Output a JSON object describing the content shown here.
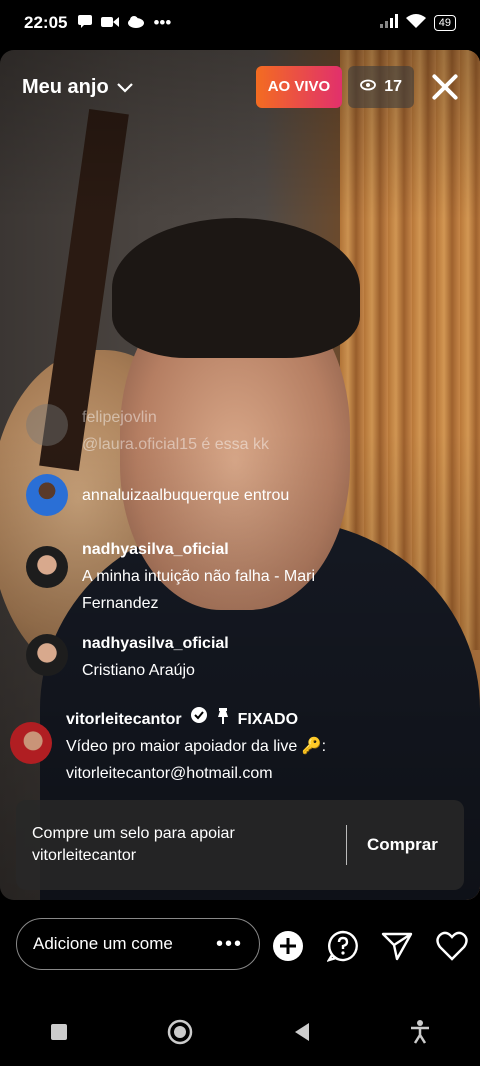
{
  "status_bar": {
    "time": "22:05",
    "battery": "49"
  },
  "header": {
    "title": "Meu anjo",
    "live_label": "AO VIVO",
    "viewer_count": "17"
  },
  "comments": [
    {
      "user": "felipejovlin",
      "text": "@laura.oficial15 é essa kk"
    },
    {
      "user": "",
      "text": "annaluizaalbuquerque entrou"
    },
    {
      "user": "nadhyasilva_oficial",
      "text": "A minha intuição não falha - Mari Fernandez"
    },
    {
      "user": "nadhyasilva_oficial",
      "text": "Cristiano Araújo"
    }
  ],
  "pinned": {
    "user": "vitorleitecantor",
    "pinned_label": "FIXADO",
    "text": "Vídeo pro maior apoiador da live 🔑:",
    "email": "vitorleitecantor@hotmail.com"
  },
  "support": {
    "message": "Compre um selo para apoiar vitorleitecantor",
    "button": "Comprar"
  },
  "comment_input": {
    "placeholder": "Adicione um come",
    "more": "•••"
  },
  "icons": [
    "add-icon",
    "question-icon",
    "share-icon",
    "heart-icon"
  ]
}
